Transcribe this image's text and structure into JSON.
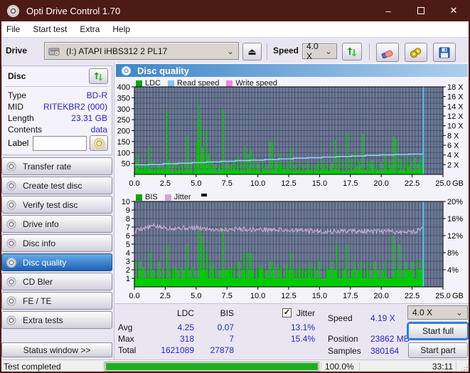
{
  "window": {
    "title": "Opti Drive Control 1.70"
  },
  "icons": {
    "minimize": "–",
    "close": "✕",
    "eject": "⏏",
    "chevron": "⌄",
    "check": "✓"
  },
  "menu": {
    "items": [
      "File",
      "Start test",
      "Extra",
      "Help"
    ]
  },
  "toolbar": {
    "drive_label": "Drive",
    "drive_value": "(I:)   ATAPI iHBS312   2 PL17",
    "speed_label": "Speed",
    "speed_value": "4.0 X"
  },
  "sidebar": {
    "panel_title": "Disc",
    "fields": [
      {
        "label": "Type",
        "value": "BD-R"
      },
      {
        "label": "MID",
        "value": "RITEKBR2 (000)"
      },
      {
        "label": "Length",
        "value": "23.31 GB"
      },
      {
        "label": "Contents",
        "value": "data"
      }
    ],
    "label_field": {
      "label": "Label",
      "value": ""
    },
    "buttons": [
      {
        "label": "Transfer rate",
        "selected": false
      },
      {
        "label": "Create test disc",
        "selected": false
      },
      {
        "label": "Verify test disc",
        "selected": false
      },
      {
        "label": "Drive info",
        "selected": false
      },
      {
        "label": "Disc info",
        "selected": false
      },
      {
        "label": "Disc quality",
        "selected": true
      },
      {
        "label": "CD Bler",
        "selected": false
      },
      {
        "label": "FE / TE",
        "selected": false
      },
      {
        "label": "Extra tests",
        "selected": false
      }
    ],
    "status_window_button": "Status window >>"
  },
  "main": {
    "header": "Disc quality"
  },
  "results": {
    "col_ldc": "LDC",
    "col_bis": "BIS",
    "jitter_label": "Jitter",
    "jitter_checked": true,
    "rows": [
      {
        "label": "Avg",
        "ldc": "4.25",
        "bis": "0.07",
        "jitter": "13.1%"
      },
      {
        "label": "Max",
        "ldc": "318",
        "bis": "7",
        "jitter": "15.4%"
      },
      {
        "label": "Total",
        "ldc": "1621089",
        "bis": "27878",
        "jitter": ""
      }
    ],
    "speed_label": "Speed",
    "speed_value": "4.19 X",
    "position_label": "Position",
    "position_value": "23862 MB",
    "samples_label": "Samples",
    "samples_value": "380164",
    "speed_select": "4.0 X",
    "start_full": "Start full",
    "start_part": "Start part"
  },
  "statusbar": {
    "text": "Test completed",
    "percent": "100.0%",
    "time": "33:11"
  },
  "chart_data": [
    {
      "type": "bar",
      "title": "LDC / Read speed / Write speed vs position",
      "legend": [
        {
          "label": "LDC",
          "color": "#00a800"
        },
        {
          "label": "Read speed",
          "color": "#7ec6f2"
        },
        {
          "label": "Write speed",
          "color": "#f583e8"
        }
      ],
      "x_ticks": [
        "0.0",
        "2.5",
        "5.0",
        "7.5",
        "10.0",
        "12.5",
        "15.0",
        "17.5",
        "20.0",
        "22.5",
        "25.0"
      ],
      "x_unit": "GB",
      "x_range": [
        0,
        25
      ],
      "y_left_ticks": [
        400,
        350,
        300,
        250,
        200,
        150,
        100,
        50
      ],
      "y_left_range": [
        0,
        400
      ],
      "y_right_ticks": [
        [
          "18 X",
          400
        ],
        [
          "16 X",
          355.6
        ],
        [
          "14 X",
          311.1
        ],
        [
          "12 X",
          266.7
        ],
        [
          "10 X",
          222.2
        ],
        [
          "8 X",
          177.8
        ],
        [
          "6 X",
          133.3
        ],
        [
          "4 X",
          88.9
        ],
        [
          "2 X",
          44.4
        ]
      ],
      "grid": {
        "x_step": 0.25,
        "y_step": 25
      },
      "data_end_x": 23.4,
      "colors": {
        "bg": "#6e7b97",
        "grid": "#46506a",
        "cyan": "#4fc7f5"
      },
      "bars": {
        "color": "#00cc00",
        "noise": {
          "seed": 7,
          "step": 0.07,
          "min": 4,
          "max": 28,
          "mode": "ldc"
        },
        "spikes": [
          [
            0.15,
            60
          ],
          [
            0.3,
            95
          ],
          [
            0.55,
            42
          ],
          [
            0.8,
            50
          ],
          [
            1.05,
            45
          ],
          [
            1.2,
            130
          ],
          [
            1.45,
            55
          ],
          [
            1.7,
            42
          ],
          [
            2.0,
            46
          ],
          [
            2.3,
            52
          ],
          [
            2.65,
            290
          ],
          [
            2.78,
            65
          ],
          [
            3.05,
            42
          ],
          [
            3.3,
            56
          ],
          [
            3.6,
            50
          ],
          [
            3.9,
            46
          ],
          [
            4.3,
            180
          ],
          [
            4.55,
            60
          ],
          [
            4.9,
            55
          ],
          [
            5.08,
            150
          ],
          [
            5.2,
            320
          ],
          [
            5.32,
            250
          ],
          [
            5.5,
            125
          ],
          [
            5.65,
            92
          ],
          [
            5.82,
            200
          ],
          [
            6.0,
            96
          ],
          [
            6.2,
            62
          ],
          [
            6.5,
            46
          ],
          [
            6.85,
            42
          ],
          [
            7.2,
            295
          ],
          [
            7.5,
            56
          ],
          [
            7.8,
            46
          ],
          [
            8.1,
            60
          ],
          [
            8.4,
            82
          ],
          [
            8.7,
            56
          ],
          [
            8.95,
            130
          ],
          [
            9.2,
            92
          ],
          [
            9.45,
            115
          ],
          [
            9.7,
            76
          ],
          [
            10.0,
            52
          ],
          [
            10.4,
            62
          ],
          [
            10.75,
            46
          ],
          [
            11.0,
            150
          ],
          [
            11.2,
            145
          ],
          [
            11.5,
            62
          ],
          [
            11.8,
            96
          ],
          [
            12.1,
            52
          ],
          [
            12.45,
            56
          ],
          [
            12.7,
            120
          ],
          [
            13.05,
            46
          ],
          [
            13.35,
            56
          ],
          [
            13.7,
            42
          ],
          [
            14.05,
            62
          ],
          [
            14.4,
            46
          ],
          [
            14.8,
            42
          ],
          [
            15.2,
            66
          ],
          [
            15.6,
            52
          ],
          [
            16.0,
            56
          ],
          [
            16.3,
            155
          ],
          [
            16.55,
            92
          ],
          [
            16.9,
            62
          ],
          [
            17.2,
            185
          ],
          [
            17.55,
            72
          ],
          [
            17.9,
            110
          ],
          [
            18.2,
            62
          ],
          [
            18.5,
            185
          ],
          [
            18.9,
            56
          ],
          [
            19.25,
            66
          ],
          [
            19.6,
            52
          ],
          [
            20.0,
            56
          ],
          [
            20.3,
            100
          ],
          [
            20.7,
            62
          ],
          [
            21.0,
            175
          ],
          [
            21.2,
            160
          ],
          [
            21.55,
            72
          ],
          [
            21.85,
            56
          ],
          [
            22.1,
            92
          ],
          [
            22.45,
            62
          ],
          [
            22.75,
            76
          ],
          [
            23.0,
            52
          ],
          [
            23.2,
            85
          ],
          [
            23.35,
            62
          ]
        ]
      },
      "line": {
        "name": "read-speed",
        "color": "#92cdf2",
        "mode": "step",
        "points": [
          [
            0,
            44
          ],
          [
            1.17,
            46
          ],
          [
            2.34,
            49
          ],
          [
            3.5,
            51
          ],
          [
            4.68,
            54
          ],
          [
            5.85,
            57
          ],
          [
            7.02,
            60
          ],
          [
            8.19,
            63
          ],
          [
            9.36,
            65
          ],
          [
            10.53,
            68
          ],
          [
            11.7,
            71
          ],
          [
            12.87,
            74
          ],
          [
            14.04,
            76
          ],
          [
            15.21,
            79
          ],
          [
            16.38,
            81
          ],
          [
            17.55,
            84
          ],
          [
            18.72,
            87
          ],
          [
            19.89,
            89
          ],
          [
            21.06,
            91
          ],
          [
            22.23,
            93
          ],
          [
            23.4,
            95
          ]
        ]
      },
      "end_marker": {
        "x": 23.42
      }
    },
    {
      "type": "bar",
      "title": "BIS / Jitter vs position",
      "legend": [
        {
          "label": "BIS",
          "color": "#00a800"
        },
        {
          "label": "Jitter",
          "color": "#cfa6d8"
        }
      ],
      "x_ticks": [
        "0.0",
        "2.5",
        "5.0",
        "7.5",
        "10.0",
        "12.5",
        "15.0",
        "17.5",
        "20.0",
        "22.5",
        "25.0"
      ],
      "x_unit": "GB",
      "x_range": [
        0,
        25
      ],
      "y_left_ticks": [
        10,
        9,
        8,
        7,
        6,
        5,
        4,
        3,
        2,
        1
      ],
      "y_left_range": [
        0,
        10
      ],
      "y_right_ticks": [
        [
          "20%",
          10
        ],
        [
          "16%",
          8
        ],
        [
          "12%",
          6
        ],
        [
          "8%",
          4
        ],
        [
          "4%",
          2
        ]
      ],
      "grid": {
        "x_step": 0.25,
        "y_step": 1
      },
      "data_end_x": 23.4,
      "colors": {
        "bg": "#6e7b97",
        "grid": "#46506a",
        "cyan": "#4fc7f5"
      },
      "bars": {
        "color": "#00cc00",
        "noise": {
          "seed": 11,
          "step": 0.07,
          "min": 1,
          "max": 2,
          "mode": "bis"
        },
        "spikes": [
          [
            0.15,
            3
          ],
          [
            0.5,
            3
          ],
          [
            0.75,
            2.2
          ],
          [
            1.3,
            4
          ],
          [
            2.0,
            3
          ],
          [
            2.3,
            2.2
          ],
          [
            2.7,
            5
          ],
          [
            3.3,
            2.4
          ],
          [
            3.8,
            2.2
          ],
          [
            4.3,
            5
          ],
          [
            4.7,
            2.4
          ],
          [
            5.2,
            6.6
          ],
          [
            5.45,
            6
          ],
          [
            5.6,
            5
          ],
          [
            5.9,
            4
          ],
          [
            6.2,
            3
          ],
          [
            6.6,
            2.4
          ],
          [
            7.2,
            6.6
          ],
          [
            7.7,
            2.4
          ],
          [
            8.1,
            2.6
          ],
          [
            8.5,
            3
          ],
          [
            8.9,
            4
          ],
          [
            9.2,
            4
          ],
          [
            9.45,
            4
          ],
          [
            9.9,
            2.4
          ],
          [
            10.3,
            2.6
          ],
          [
            11.0,
            3
          ],
          [
            11.3,
            3
          ],
          [
            11.9,
            2.4
          ],
          [
            12.3,
            2.6
          ],
          [
            12.7,
            4
          ],
          [
            13.4,
            2.4
          ],
          [
            14.2,
            3
          ],
          [
            15.0,
            3
          ],
          [
            15.6,
            2.4
          ],
          [
            16.0,
            3
          ],
          [
            16.4,
            5
          ],
          [
            17.2,
            5
          ],
          [
            17.8,
            3
          ],
          [
            18.3,
            3
          ],
          [
            18.9,
            3
          ],
          [
            19.5,
            3
          ],
          [
            20.3,
            3
          ],
          [
            21.0,
            6
          ],
          [
            21.5,
            5
          ],
          [
            22.0,
            3
          ],
          [
            22.5,
            3
          ],
          [
            22.9,
            3
          ],
          [
            23.3,
            3.3
          ]
        ]
      },
      "line": {
        "name": "jitter",
        "color": "#d9aede",
        "mode": "noisy",
        "noise": {
          "seed": 5,
          "amp": 0.28,
          "step": 0.06
        },
        "points": [
          [
            0,
            6.2
          ],
          [
            0.25,
            6.8
          ],
          [
            0.9,
            6.9
          ],
          [
            1.6,
            7.15
          ],
          [
            2.2,
            6.95
          ],
          [
            3.2,
            6.9
          ],
          [
            4.5,
            6.9
          ],
          [
            5.5,
            6.85
          ],
          [
            7.0,
            6.7
          ],
          [
            8.5,
            6.8
          ],
          [
            10.0,
            6.7
          ],
          [
            11.5,
            6.7
          ],
          [
            13.0,
            6.6
          ],
          [
            14.5,
            6.55
          ],
          [
            16.0,
            6.45
          ],
          [
            17.5,
            6.55
          ],
          [
            19.0,
            6.45
          ],
          [
            20.5,
            6.5
          ],
          [
            21.8,
            6.4
          ],
          [
            22.8,
            6.5
          ],
          [
            23.3,
            6.9
          ]
        ]
      },
      "end_marker": {
        "x": 23.42
      }
    }
  ]
}
